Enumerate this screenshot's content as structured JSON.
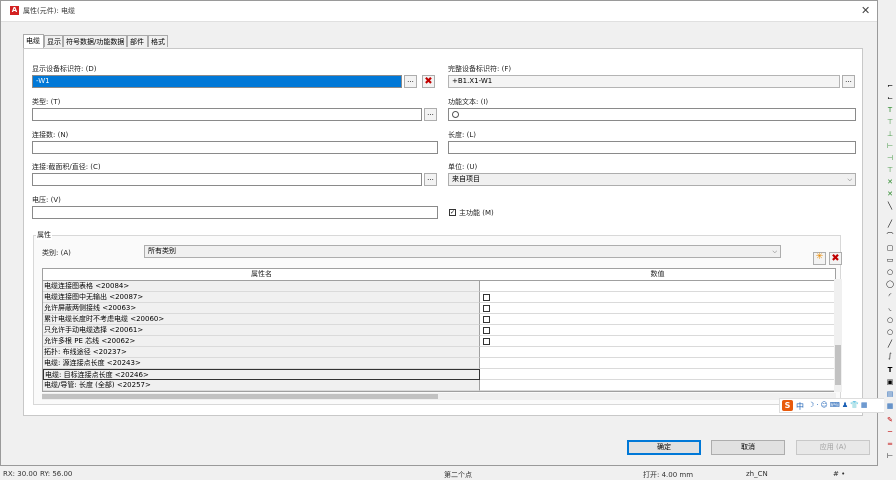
{
  "window": {
    "title": "属性(元件): 电缆",
    "app_icon": "app-icon",
    "close_icon": "close-icon"
  },
  "tabs": [
    {
      "label": "电缆",
      "active": true
    },
    {
      "label": "显示",
      "active": false
    },
    {
      "label": "符号数据/功能数据",
      "active": false
    },
    {
      "label": "部件",
      "active": false
    },
    {
      "label": "格式",
      "active": false
    }
  ],
  "fields": {
    "display_id": {
      "label": "显示设备标识符: (D)",
      "value": "-W1"
    },
    "full_id": {
      "label": "完整设备标识符: (F)",
      "value": "+B1.X1-W1"
    },
    "type": {
      "label": "类型: (T)",
      "value": ""
    },
    "function_text": {
      "label": "功能文本: (I)",
      "value": ""
    },
    "connections": {
      "label": "连接数: (N)",
      "value": ""
    },
    "length": {
      "label": "长度: (L)",
      "value": ""
    },
    "cross_section": {
      "label": "连接:截面积/直径: (C)",
      "value": ""
    },
    "unit": {
      "label": "单位: (U)",
      "value": "来自项目"
    },
    "voltage": {
      "label": "电压: (V)",
      "value": ""
    },
    "main_function": {
      "label": "主功能 (M)",
      "checked": true
    }
  },
  "buttons": {
    "browse": "...",
    "new_icon": "new-icon",
    "delete_icon": "delete-icon"
  },
  "properties": {
    "group_title": "属性",
    "category_label": "类别: (A)",
    "category_value": "所有类别",
    "col_name": "属性名",
    "col_value": "数值",
    "rows": [
      {
        "name": "电缆连接图表格 <20084>",
        "checkbox": false
      },
      {
        "name": "电缆连接图中无输出 <20087>",
        "checkbox": true
      },
      {
        "name": "允许屏蔽两侧接线 <20063>",
        "checkbox": true
      },
      {
        "name": "累计电缆长度时不考虑电缆 <20060>",
        "checkbox": true
      },
      {
        "name": "只允许手动电缆选择 <20061>",
        "checkbox": true
      },
      {
        "name": "允许多根 PE 芯线 <20062>",
        "checkbox": true
      },
      {
        "name": "拓扑: 布线途径 <20237>",
        "checkbox": false
      },
      {
        "name": "电缆: 源连接点长度 <20243>",
        "checkbox": false
      },
      {
        "name": "电缆: 目标连接点长度 <20246>",
        "checkbox": false
      },
      {
        "name": "电缆/导管: 长度 (全部) <20257>",
        "checkbox": false
      }
    ]
  },
  "dialog_buttons": {
    "ok": "确定",
    "cancel": "取消",
    "apply": "应用 (A)"
  },
  "statusbar": {
    "rx": "RX: 30.00",
    "ry": "RY: 56.00",
    "mid": "第二个点",
    "open": "打开: 4.00 mm",
    "lang": "zh_CN",
    "hash": "# •"
  },
  "ime": {
    "logo": "S",
    "label": "中"
  },
  "colors": {
    "accent": "#0078d7",
    "danger": "#c00000",
    "app_red": "#d32121"
  }
}
